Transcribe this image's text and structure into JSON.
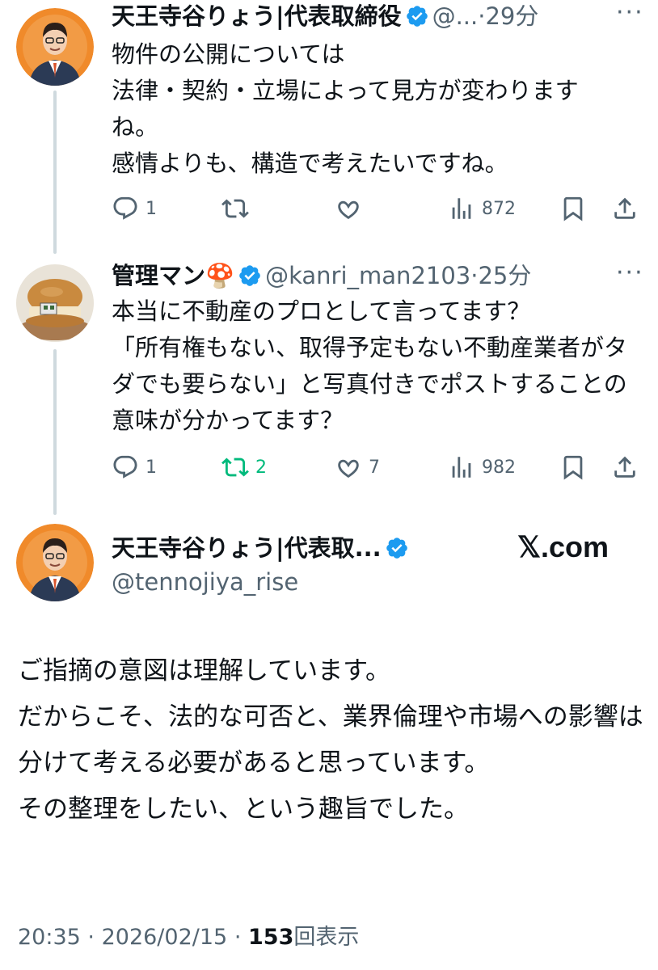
{
  "tweet1": {
    "author_name": "天王寺谷りょう|代表取締役",
    "handle": "@...",
    "separator": "·",
    "time": "29分",
    "text": "物件の公開については\n法律・契約・立場によって見方が変わります ね。\n感情よりも、構造で考えたいですね。",
    "actions": {
      "replies": "1",
      "views": "872"
    }
  },
  "tweet2": {
    "author_name": "管理マン",
    "author_emoji": "🍄",
    "handle": "@kanri_man2103",
    "separator": "·",
    "time": "25分",
    "text": "本当に不動産のプロとして言ってます？\n「所有権もない、取得予定もない不動産業者がタダでも要らない」と写真付きでポストすることの意味が分かってます？",
    "actions": {
      "replies": "1",
      "reposts": "2",
      "likes": "7",
      "views": "982"
    }
  },
  "main_tweet": {
    "author_name": "天王寺谷りょう|代表取...",
    "handle": "@tennojiya_rise",
    "watermark": "𝕏.com",
    "text": "ご指摘の意図は理解しています。\nだからこそ、法的な可否と、業界倫理や市場への影響は分けて考える必要があると思っています。\nその整理をしたい、という趣旨でした。",
    "time": "20:35",
    "date": "2026/02/15",
    "dot": "·",
    "views_count": "153",
    "views_label": "回表示"
  },
  "icons": [
    "reply-icon",
    "repost-icon",
    "like-icon",
    "views-icon",
    "bookmark-icon",
    "share-icon",
    "verified-icon",
    "more-icon"
  ],
  "colors": {
    "text": "#0f1419",
    "secondary": "#536471",
    "verified": "#1d9bf0",
    "repost_active": "#00ba7c",
    "thread_line": "#cfd9de"
  }
}
